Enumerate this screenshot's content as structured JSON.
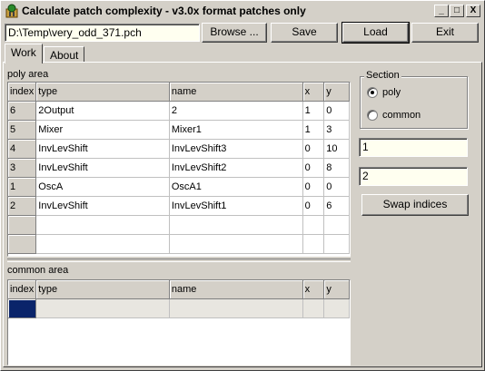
{
  "window": {
    "title": "Calculate patch complexity - v3.0x format patches only",
    "caption_buttons": {
      "minimize": "_",
      "maximize": "□",
      "close": "X"
    }
  },
  "file": {
    "path": "D:\\Temp\\very_odd_371.pch"
  },
  "toolbar": {
    "browse_label": "Browse ...",
    "save_label": "Save",
    "load_label": "Load",
    "exit_label": "Exit"
  },
  "tabs": [
    {
      "label": "Work"
    },
    {
      "label": "About"
    }
  ],
  "poly_area": {
    "label": "poly area",
    "columns": [
      "index",
      "type",
      "name",
      "x",
      "y"
    ],
    "rows": [
      {
        "index": "6",
        "type": "2Output",
        "name": "2",
        "x": "1",
        "y": "0"
      },
      {
        "index": "5",
        "type": "Mixer",
        "name": "Mixer1",
        "x": "1",
        "y": "3"
      },
      {
        "index": "4",
        "type": "InvLevShift",
        "name": "InvLevShift3",
        "x": "0",
        "y": "10"
      },
      {
        "index": "3",
        "type": "InvLevShift",
        "name": "InvLevShift2",
        "x": "0",
        "y": "8"
      },
      {
        "index": "1",
        "type": "OscA",
        "name": "OscA1",
        "x": "0",
        "y": "0"
      },
      {
        "index": "2",
        "type": "InvLevShift",
        "name": "InvLevShift1",
        "x": "0",
        "y": "6"
      }
    ]
  },
  "common_area": {
    "label": "common area",
    "columns": [
      "index",
      "type",
      "name",
      "x",
      "y"
    ]
  },
  "section": {
    "label": "Section",
    "options": [
      "poly",
      "common"
    ],
    "selected": "poly"
  },
  "index_fields": {
    "first": "1",
    "second": "2"
  },
  "swap_button_label": "Swap indices",
  "colors": {
    "selection": "#0a246a",
    "face": "#d4d0c8"
  }
}
